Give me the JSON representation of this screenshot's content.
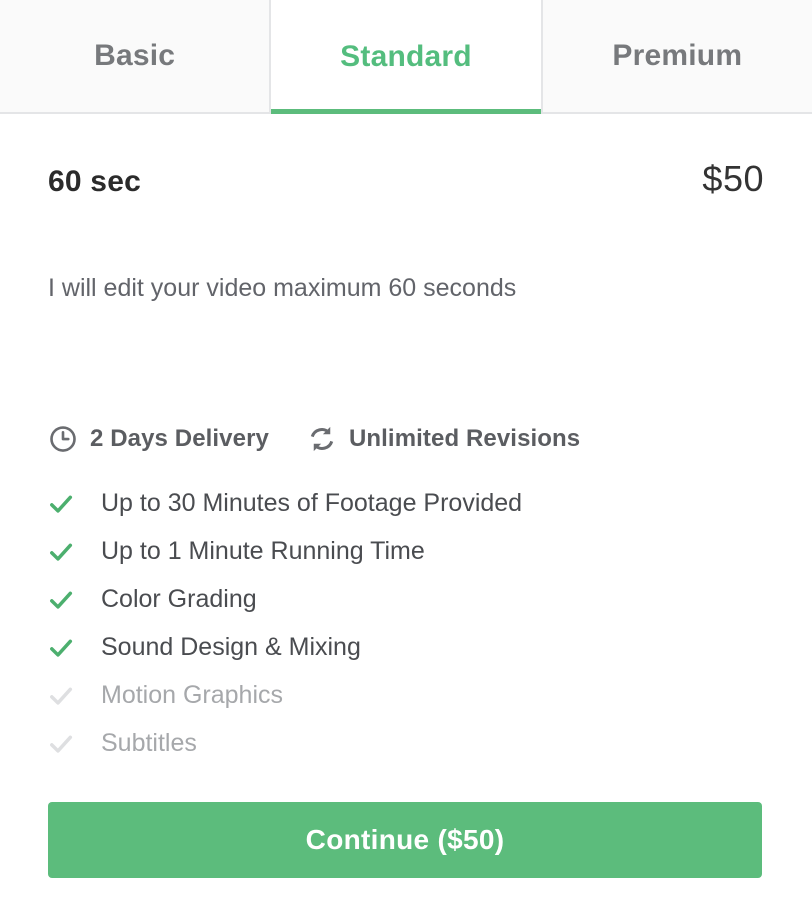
{
  "theme": {
    "accent_green": "#5cbc7c",
    "active_tab_text": "#54bd7e",
    "inactive_tab_text": "#77797c",
    "muted_text": "#a6a8ab",
    "border": "#e4e5e7"
  },
  "tabs": [
    {
      "label": "Basic",
      "active": false
    },
    {
      "label": "Standard",
      "active": true
    },
    {
      "label": "Premium",
      "active": false
    }
  ],
  "package": {
    "duration": "60 sec",
    "price": "$50",
    "description": "I will edit your video maximum 60 seconds"
  },
  "meta": [
    {
      "icon": "clock-icon",
      "label": "2 Days Delivery"
    },
    {
      "icon": "revisions-icon",
      "label": "Unlimited Revisions"
    }
  ],
  "features": [
    {
      "label": "Up to 30 Minutes of Footage Provided",
      "included": true
    },
    {
      "label": "Up to 1 Minute Running Time",
      "included": true
    },
    {
      "label": "Color Grading",
      "included": true
    },
    {
      "label": "Sound Design & Mixing",
      "included": true
    },
    {
      "label": "Motion Graphics",
      "included": false
    },
    {
      "label": "Subtitles",
      "included": false
    }
  ],
  "cta": {
    "label": "Continue ($50)"
  }
}
